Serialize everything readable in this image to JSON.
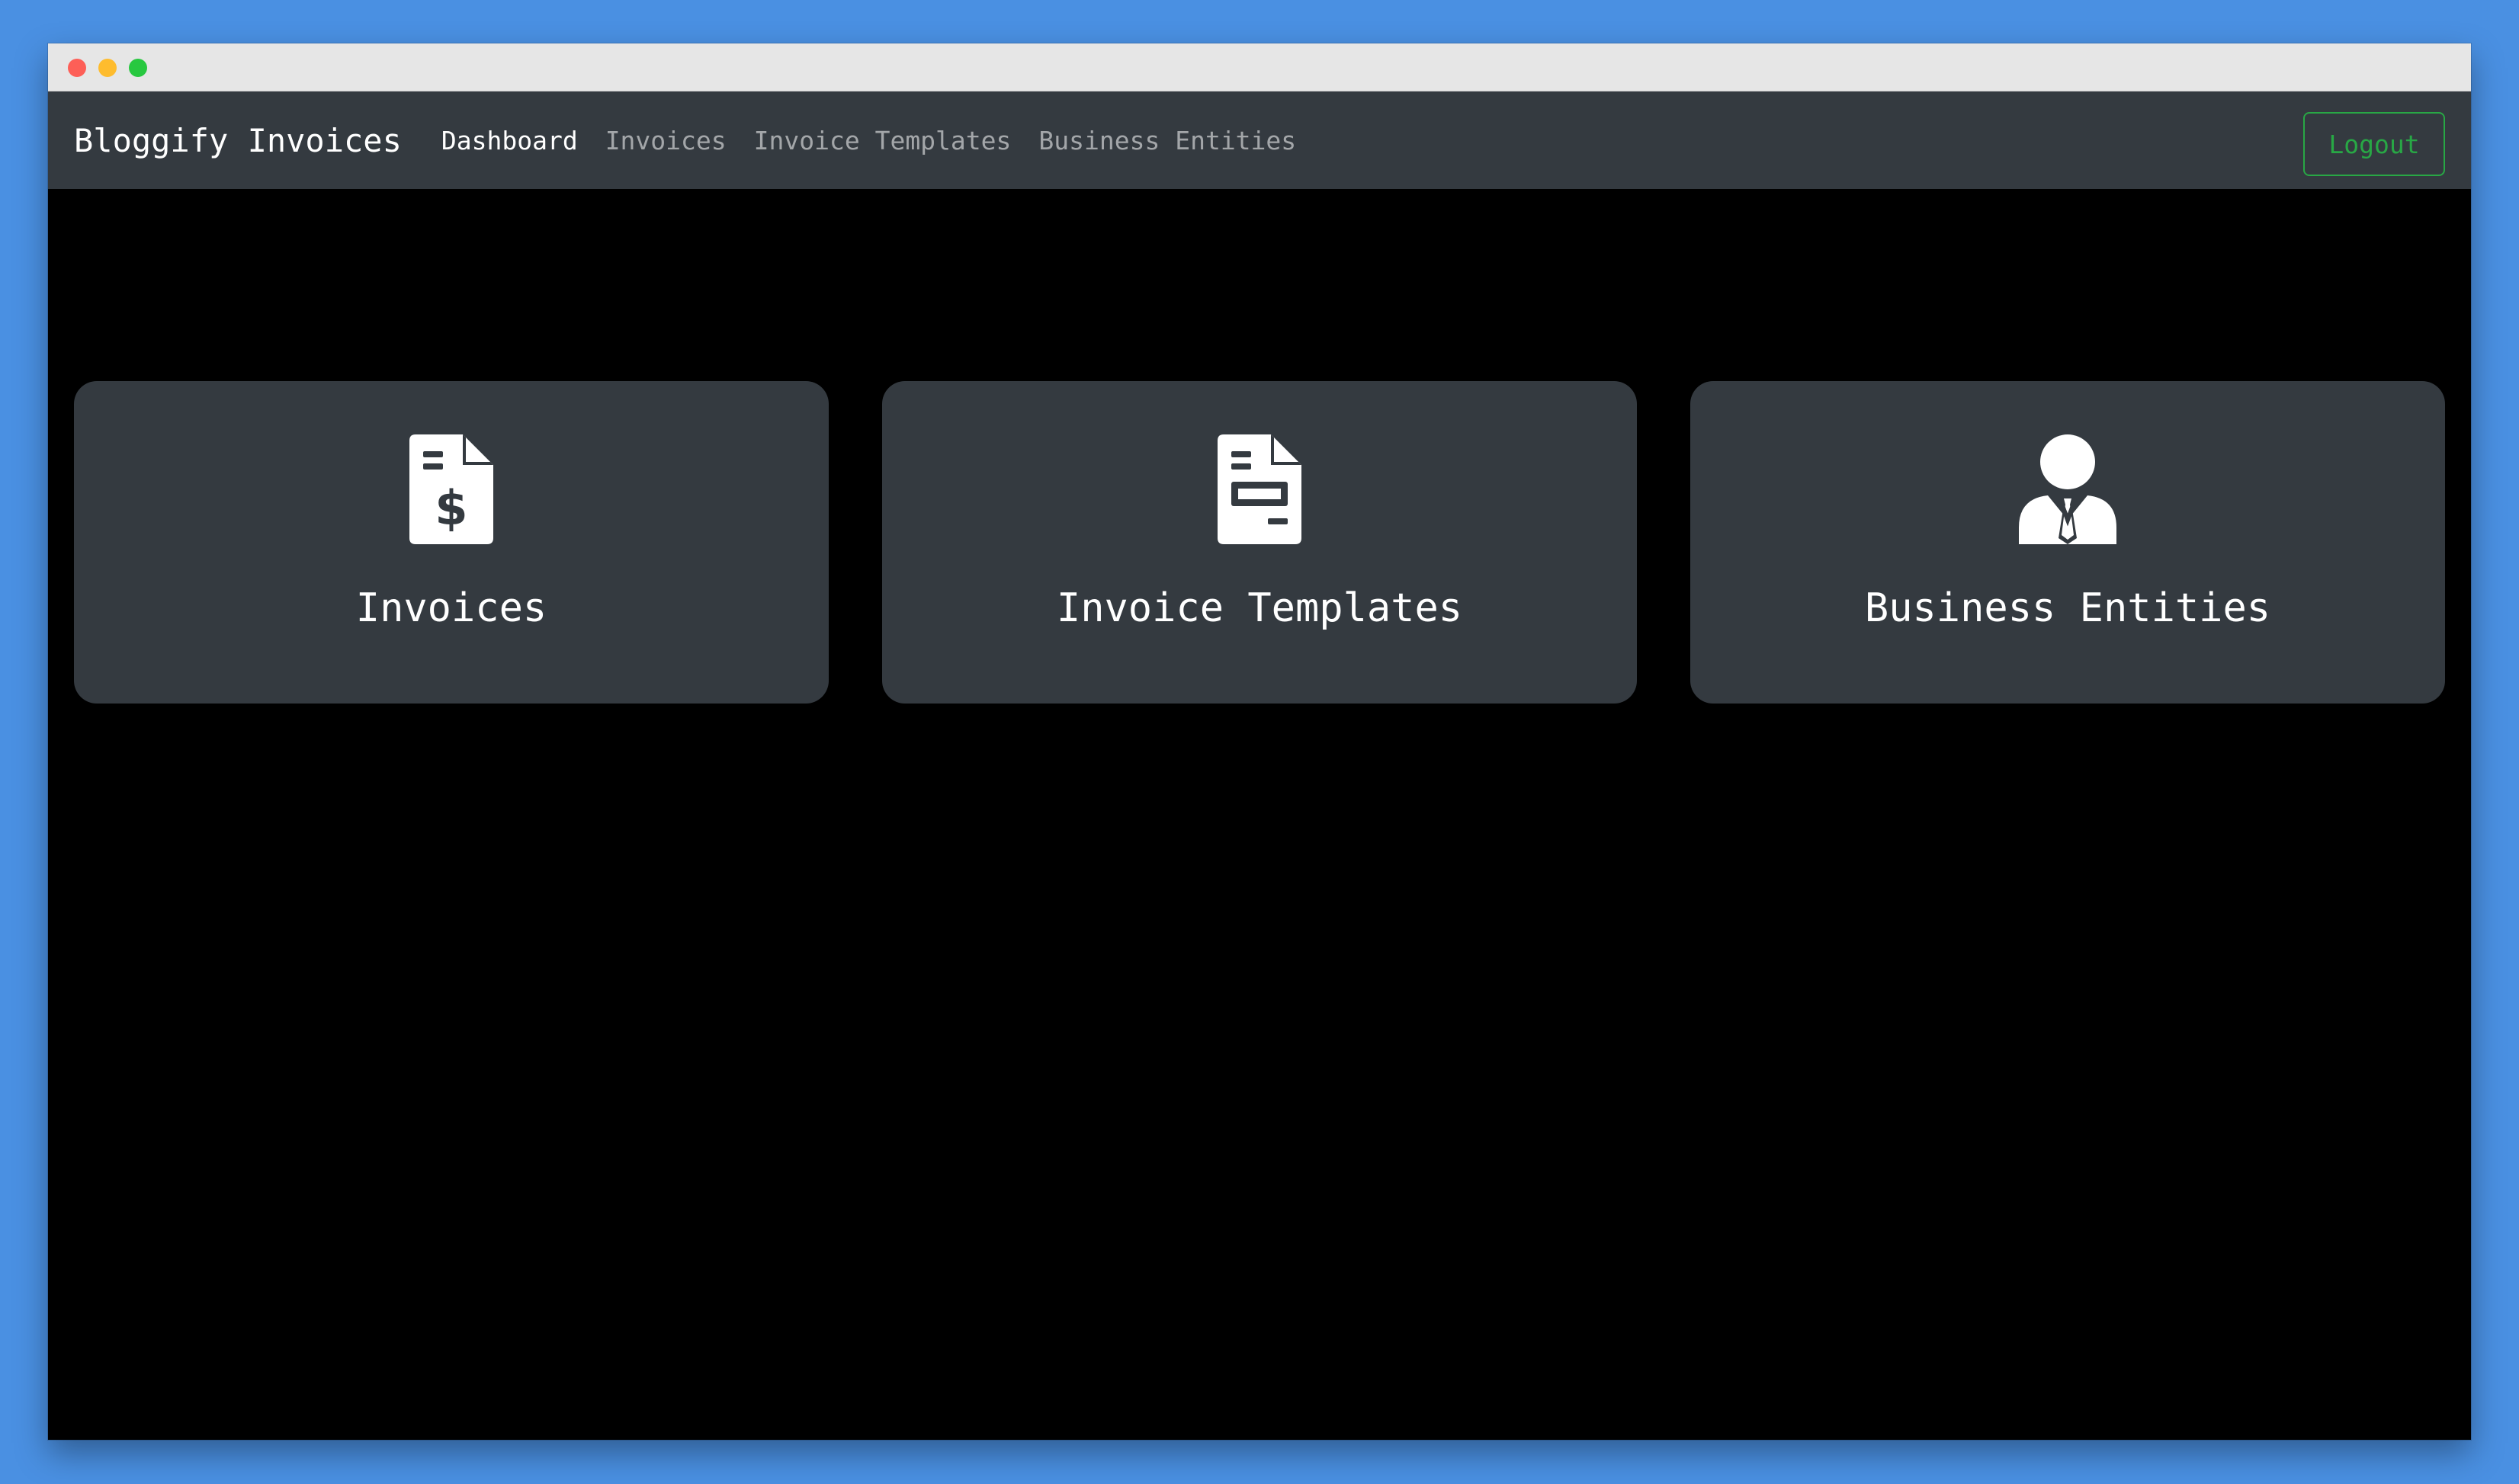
{
  "window": {
    "controls": [
      "close",
      "minimize",
      "zoom"
    ]
  },
  "navbar": {
    "brand": "Bloggify Invoices",
    "links": [
      {
        "label": "Dashboard",
        "active": true
      },
      {
        "label": "Invoices",
        "active": false
      },
      {
        "label": "Invoice Templates",
        "active": false
      },
      {
        "label": "Business Entities",
        "active": false
      }
    ],
    "logout_label": "Logout"
  },
  "cards": [
    {
      "title": "Invoices",
      "icon": "file-invoice-dollar-icon"
    },
    {
      "title": "Invoice Templates",
      "icon": "file-invoice-icon"
    },
    {
      "title": "Business Entities",
      "icon": "user-tie-icon"
    }
  ],
  "colors": {
    "background": "#000000",
    "navbar": "#343a40",
    "card": "#343a40",
    "logout_accent": "#28a745",
    "desktop": "#4a90e2"
  }
}
